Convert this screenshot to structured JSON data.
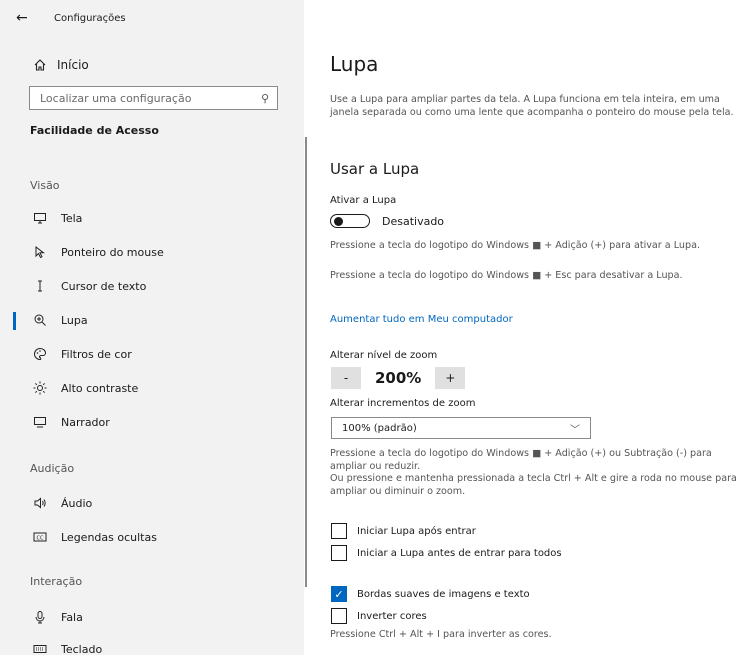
{
  "sidebar": {
    "title": "Configurações",
    "home_label": "Início",
    "search_placeholder": "Localizar uma configuração",
    "category": "Facilidade de Acesso",
    "sections": {
      "vision": "Visão",
      "hearing": "Audição",
      "interaction": "Interação"
    },
    "items": [
      {
        "label": "Tela",
        "icon": "monitor-icon"
      },
      {
        "label": "Ponteiro do mouse",
        "icon": "pointer-icon"
      },
      {
        "label": "Cursor de texto",
        "icon": "text-cursor-icon"
      },
      {
        "label": "Lupa",
        "icon": "magnifier-icon",
        "active": true
      },
      {
        "label": "Filtros de cor",
        "icon": "palette-icon"
      },
      {
        "label": "Alto contraste",
        "icon": "sun-icon"
      },
      {
        "label": "Narrador",
        "icon": "narrator-icon"
      },
      {
        "label": "Áudio",
        "icon": "speaker-icon"
      },
      {
        "label": "Legendas ocultas",
        "icon": "cc-icon"
      },
      {
        "label": "Fala",
        "icon": "microphone-icon"
      },
      {
        "label": "Teclado",
        "icon": "keyboard-icon"
      }
    ]
  },
  "main": {
    "title": "Lupa",
    "intro": "Use a Lupa para ampliar partes da tela. A Lupa funciona em tela inteira, em uma janela separada ou como uma lente que acompanha o ponteiro do mouse pela tela.",
    "section_title": "Usar a Lupa",
    "toggle_label": "Ativar a Lupa",
    "toggle_state": "Desativado",
    "hint_on": "Pressione a tecla do logotipo do Windows ■ + Adição (+) para ativar a Lupa.",
    "hint_off": "Pressione a tecla do logotipo do Windows ■ + Esc para desativar a Lupa.",
    "link": "Aumentar tudo em Meu computador",
    "zoom_label": "Alterar nível de zoom",
    "zoom_minus": "-",
    "zoom_value": "200%",
    "zoom_plus": "+",
    "increment_label": "Alterar incrementos de zoom",
    "increment_value": "100% (padrão)",
    "zoom_hint": "Pressione a tecla do logotipo do Windows ■ + Adição (+) ou Subtração (-) para ampliar ou reduzir.\nOu pressione e mantenha pressionada a tecla Ctrl + Alt e gire a roda no mouse para ampliar ou diminuir o zoom.",
    "checkboxes": [
      {
        "label": "Iniciar Lupa após entrar",
        "checked": false
      },
      {
        "label": "Iniciar a Lupa antes de entrar para todos",
        "checked": false
      },
      {
        "label": "Bordas suaves de imagens e texto",
        "checked": true
      },
      {
        "label": "Inverter cores",
        "checked": false
      }
    ],
    "invert_hint": "Pressione Ctrl + Alt + I para inverter as cores."
  },
  "colors": {
    "accent": "#0067c0",
    "sidebar_bg": "#f2f2f2"
  }
}
